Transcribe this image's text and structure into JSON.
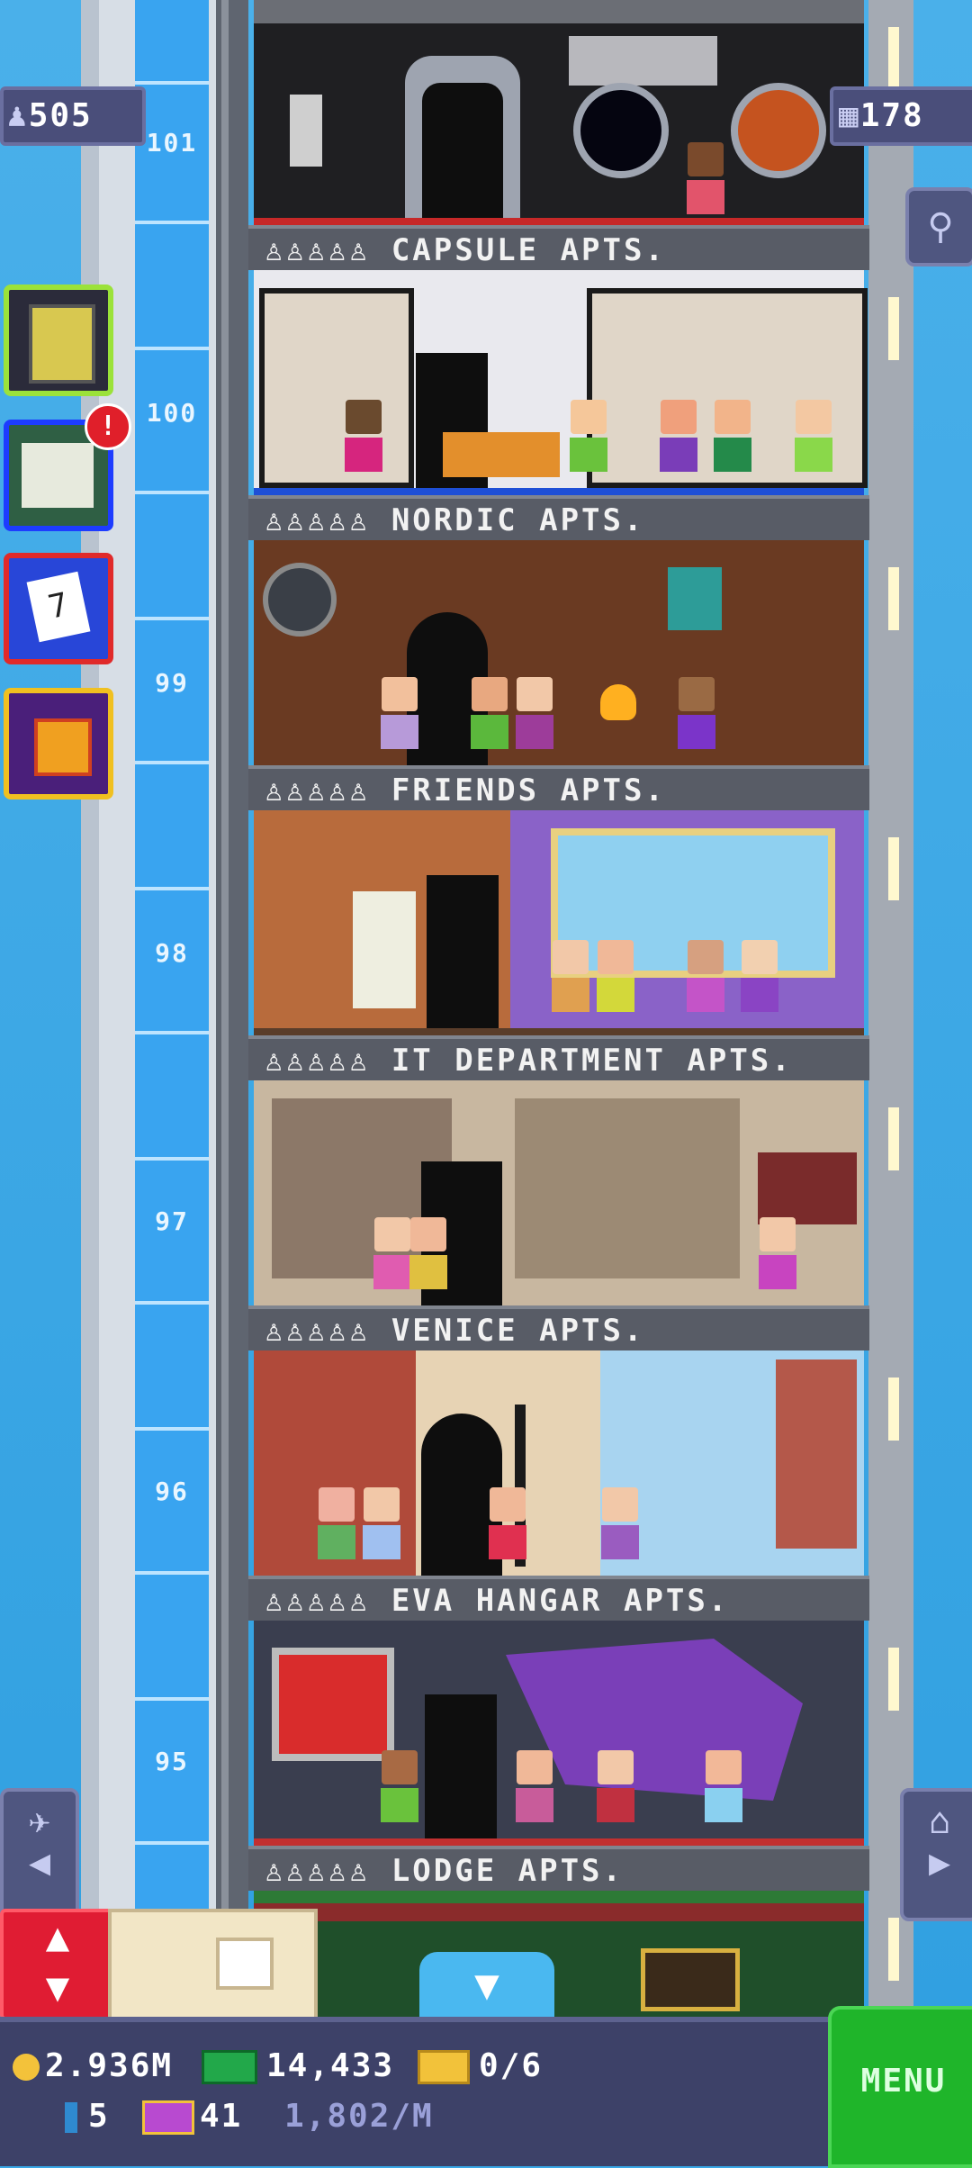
{
  "hud": {
    "population": "505",
    "floors": "178"
  },
  "floor_numbers": [
    "101",
    "100",
    "99",
    "98",
    "97",
    "96",
    "95"
  ],
  "floors": [
    {
      "name": "CAPSULE APTS.",
      "theme": "capsule",
      "wall": "#1f1f22",
      "accent": "#c62828"
    },
    {
      "name": "NORDIC APTS.",
      "theme": "nordic",
      "wall": "#e9e9ee",
      "accent": "#1e4fd6"
    },
    {
      "name": "FRIENDS APTS.",
      "theme": "nordic-wood",
      "wall": "#6a3a22",
      "accent": "#3b2316"
    },
    {
      "name": "IT DEPARTMENT APTS.",
      "theme": "friends",
      "wall": "#b86b3c",
      "accent": "#7a4bb5"
    },
    {
      "name": "VENICE APTS.",
      "theme": "it",
      "wall": "#c8b7a0",
      "accent": "#6d5a46"
    },
    {
      "name": "EVA HANGAR APTS.",
      "theme": "venice",
      "wall": "#e7d3b4",
      "accent": "#8fc6ea"
    },
    {
      "name": "LODGE APTS.",
      "theme": "eva",
      "wall": "#3a3e4f",
      "accent": "#8a3fd0"
    }
  ],
  "left_buttons": [
    {
      "name": "build-floor",
      "color": "#2b2b3a",
      "border": "#9be23a"
    },
    {
      "name": "missions",
      "color": "#2f5f44",
      "border": "#1d3cff",
      "badge": "!"
    },
    {
      "name": "calendar",
      "color": "#2846d8",
      "border": "#e02a2a",
      "day": "7"
    },
    {
      "name": "gift",
      "color": "#4a1f7a",
      "border": "#f0c020"
    }
  ],
  "bottom": {
    "coins": "2.936M",
    "bux": "14,433",
    "tickets": "0/6",
    "bitizens": "5",
    "golden_tickets": "41",
    "income": "1,802/M",
    "menu_label": "MENU"
  },
  "colors": {
    "sky": "#3aa7e6",
    "bar": "#3d4168",
    "menu": "#1fb52a"
  },
  "icons": [
    "person-icon",
    "building-icon",
    "magnifier-icon",
    "elevator-icon",
    "home-icon",
    "coin-icon",
    "bux-icon",
    "ticket-icon",
    "bitizen-icon",
    "golden-ticket-icon",
    "chevron-down-icon",
    "up-down-arrows-icon"
  ]
}
